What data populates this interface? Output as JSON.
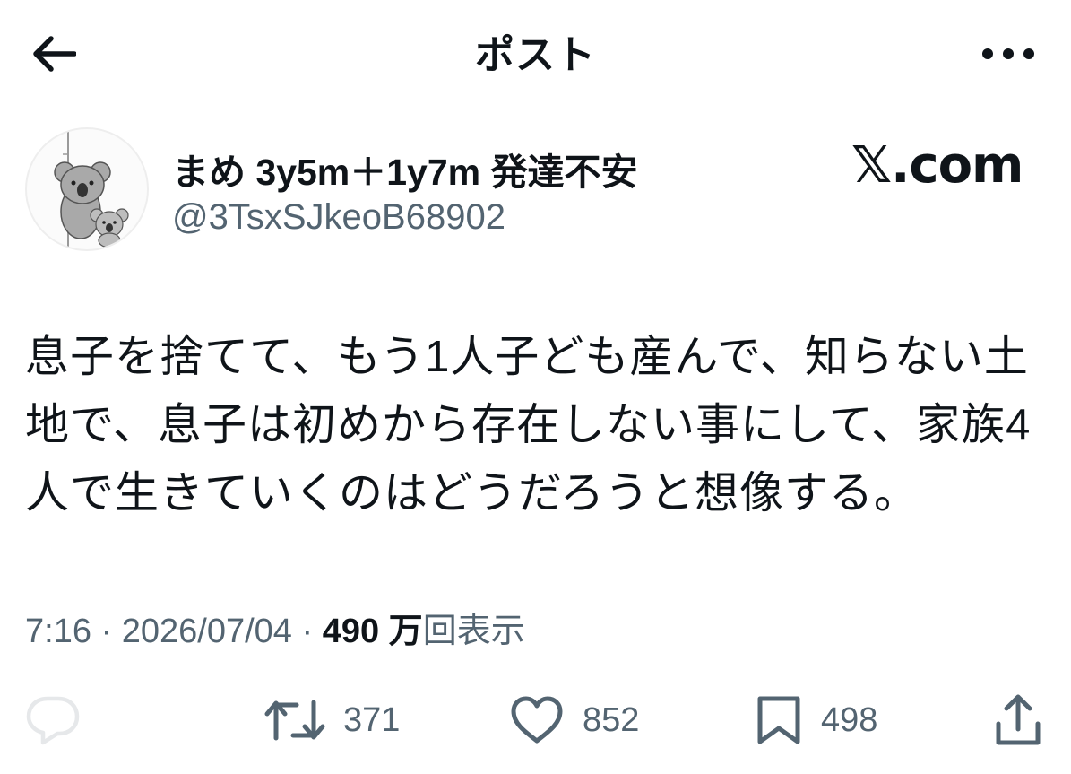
{
  "header": {
    "title": "ポスト",
    "back_icon": "arrow-left-icon",
    "more_icon": "more-horizontal-icon"
  },
  "author": {
    "display_name": "まめ 3y5m＋1y7m 発達不安",
    "handle": "@3TsxSJkeoB68902",
    "avatar_icon": "koala-avatar"
  },
  "watermark": "𝕏.com",
  "post": {
    "lines": [
      "息子を捨てて、もう1人子ども産んで、知らない土",
      "地で、息子は初めから存在しない事にして、家族4",
      "人で生きていくのはどうだろうと想像する。"
    ]
  },
  "meta": {
    "time": "7:16",
    "sep": " · ",
    "date": "2026/07/04",
    "views_count": "490 万",
    "views_label": "回表示"
  },
  "actions": {
    "reply_icon": "reply-icon",
    "repost_count": "371",
    "like_count": "852",
    "bookmark_count": "498",
    "share_icon": "share-icon"
  }
}
